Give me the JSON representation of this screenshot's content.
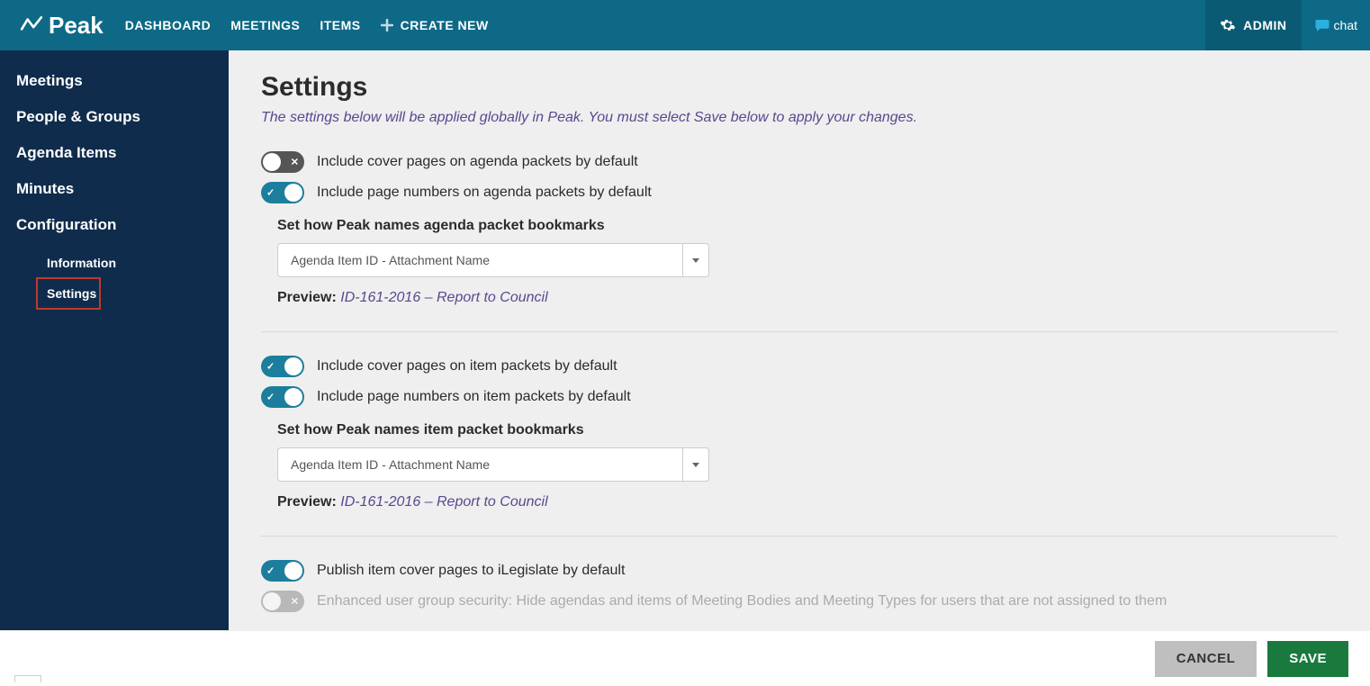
{
  "brand": "Peak",
  "topnav": {
    "dashboard": "DASHBOARD",
    "meetings": "MEETINGS",
    "items": "ITEMS",
    "create_new": "CREATE NEW"
  },
  "topright": {
    "admin": "ADMIN",
    "chat": "chat"
  },
  "sidebar": {
    "meetings": "Meetings",
    "people_groups": "People & Groups",
    "agenda_items": "Agenda Items",
    "minutes": "Minutes",
    "configuration": "Configuration",
    "sub_information": "Information",
    "sub_settings": "Settings"
  },
  "page": {
    "title": "Settings",
    "subtitle": "The settings below will be applied globally in Peak. You must select Save below to apply your changes."
  },
  "settings": {
    "agenda_cover_label": "Include cover pages on agenda packets by default",
    "agenda_pages_label": "Include page numbers on agenda packets by default",
    "agenda_bookmark_label": "Set how Peak names agenda packet bookmarks",
    "agenda_bookmark_value": "Agenda Item ID - Attachment Name",
    "agenda_preview_label": "Preview: ",
    "agenda_preview_value": "ID-161-2016 – Report to Council",
    "item_cover_label": "Include cover pages on item packets by default",
    "item_pages_label": "Include page numbers on item packets by default",
    "item_bookmark_label": "Set how Peak names item packet bookmarks",
    "item_bookmark_value": "Agenda Item ID - Attachment Name",
    "item_preview_label": "Preview: ",
    "item_preview_value": "ID-161-2016 – Report to Council",
    "publish_label": "Publish item cover pages to iLegislate by default",
    "enhanced_label": "Enhanced user group security: Hide agendas and items of Meeting Bodies and Meeting Types for users that are not assigned to them"
  },
  "footer": {
    "cancel": "CANCEL",
    "save": "SAVE"
  },
  "glyphs": {
    "check": "✓",
    "x": "✕"
  }
}
